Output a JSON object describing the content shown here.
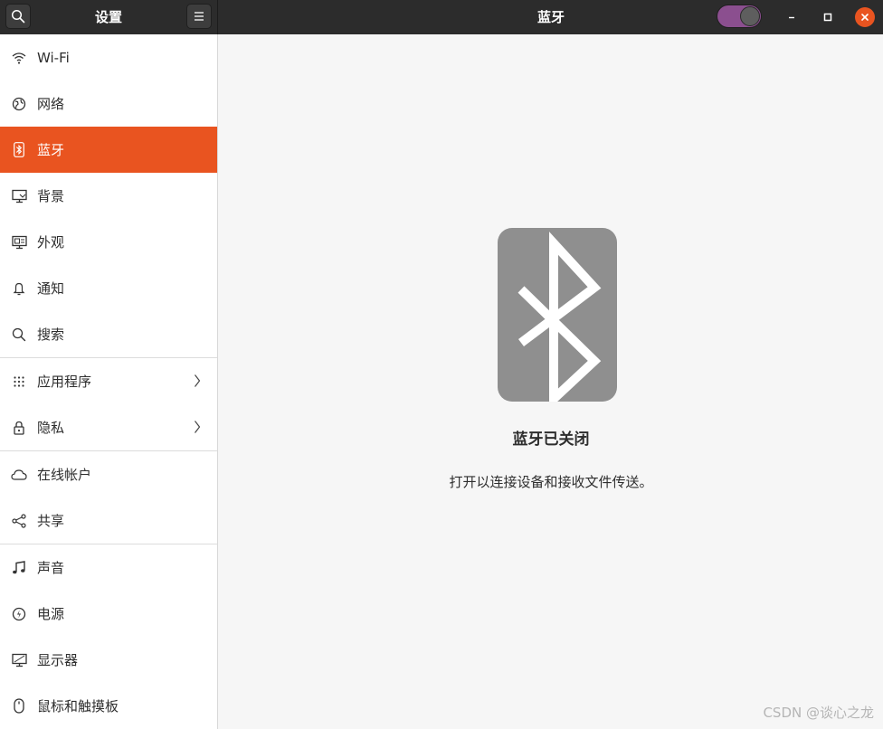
{
  "header": {
    "sidebar_title": "设置",
    "page_title": "蓝牙",
    "bluetooth_toggle_on": false
  },
  "sidebar": {
    "groups": [
      [
        {
          "label": "Wi-Fi",
          "icon": "wifi-icon"
        },
        {
          "label": "网络",
          "icon": "network-globe-icon"
        },
        {
          "label": "蓝牙",
          "icon": "bluetooth-icon",
          "active": true
        },
        {
          "label": "背景",
          "icon": "background-monitor-icon"
        },
        {
          "label": "外观",
          "icon": "appearance-icon"
        },
        {
          "label": "通知",
          "icon": "notification-bell-icon"
        },
        {
          "label": "搜索",
          "icon": "search-icon"
        }
      ],
      [
        {
          "label": "应用程序",
          "icon": "apps-grid-icon",
          "chevron": true
        },
        {
          "label": "隐私",
          "icon": "lock-icon",
          "chevron": true
        }
      ],
      [
        {
          "label": "在线帐户",
          "icon": "cloud-icon"
        },
        {
          "label": "共享",
          "icon": "share-icon"
        }
      ],
      [
        {
          "label": "声音",
          "icon": "music-note-icon"
        },
        {
          "label": "电源",
          "icon": "power-icon"
        },
        {
          "label": "显示器",
          "icon": "display-icon"
        },
        {
          "label": "鼠标和触摸板",
          "icon": "mouse-icon"
        }
      ]
    ]
  },
  "main": {
    "status_title": "蓝牙已关闭",
    "status_description": "打开以连接设备和接收文件传送。"
  },
  "watermark": "CSDN @谈心之龙"
}
